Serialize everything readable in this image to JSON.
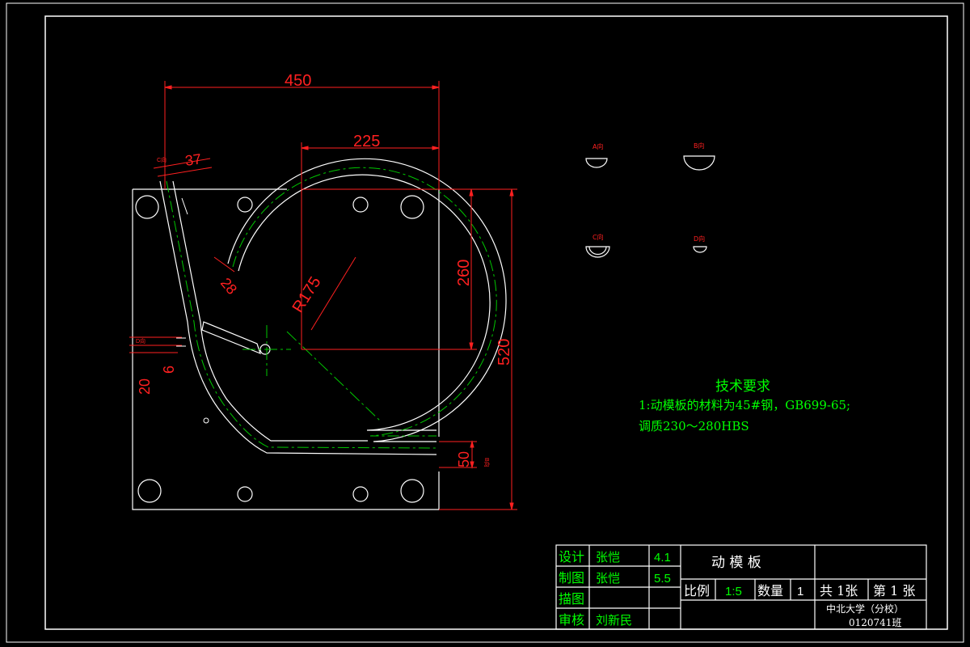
{
  "drawing": {
    "dimensions": {
      "width_total": "450",
      "half_width": "225",
      "gate_width": "37",
      "runner_width": "28",
      "radius": "R175",
      "height_upper": "260",
      "height_total": "520",
      "outlet_height": "50",
      "inlet_a": "20",
      "inlet_b": "6"
    },
    "section_labels": {
      "a": "A向",
      "b": "B向",
      "c": "C向",
      "d": "D向",
      "side_c": "C向",
      "side_b": "B向",
      "side_d": "D向"
    }
  },
  "tech_requirements": {
    "title": "技术要求",
    "line1": "1:动模板的材料为45#钢，GB699-65;",
    "line2": "调质230～280HBS"
  },
  "title_block": {
    "row_labels": [
      "设计",
      "制图",
      "描图",
      "审核"
    ],
    "row_names": [
      "张恺",
      "张恺",
      "",
      "刘新民"
    ],
    "row_dates": [
      "4.1",
      "5.5",
      "",
      ""
    ],
    "part_name": "动 模 板",
    "scale_label": "比例",
    "scale_value": "1:5",
    "qty_label": "数量",
    "qty_value": "1",
    "sheets_total": "共 1张",
    "sheet_no": "第 1 张",
    "school": "中北大学（分校）",
    "class_code": "0120741班"
  },
  "colors": {
    "background": "#000000",
    "outline": "#ffffff",
    "dimension": "#ff2020",
    "centerline": "#00c800",
    "text_green": "#00ff00",
    "title_text": "#ffffff"
  }
}
